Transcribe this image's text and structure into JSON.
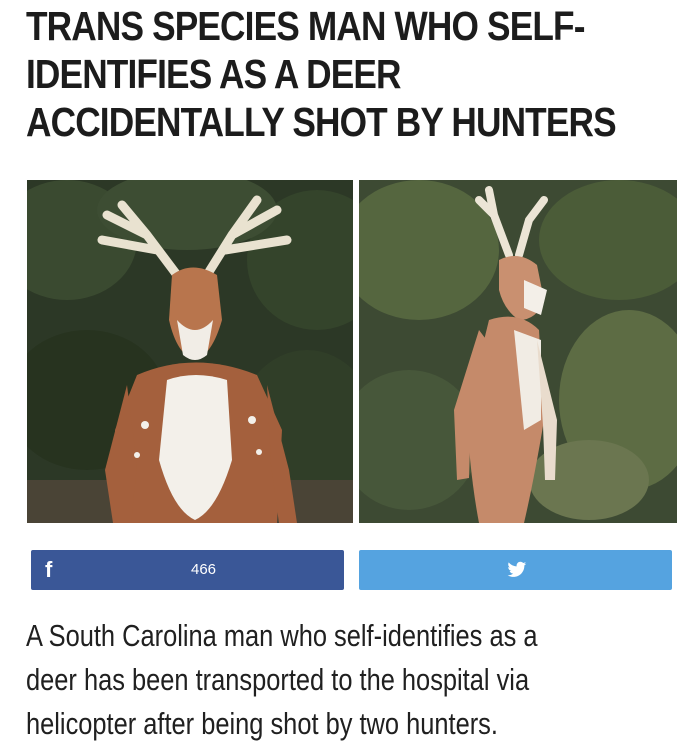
{
  "headline": {
    "lines": [
      "TRANS SPECIES MAN WHO SELF-",
      "IDENTIFIES AS A DEER",
      "ACCIDENTALLY SHOT BY HUNTERS"
    ]
  },
  "photos": {
    "left": {
      "icon": "deer-costume-photo-front"
    },
    "right": {
      "icon": "deer-costume-photo-side"
    }
  },
  "share": {
    "facebook": {
      "icon": "facebook-icon",
      "glyph": "f",
      "count": "466",
      "color": "#3a5797"
    },
    "twitter": {
      "icon": "twitter-bird-icon",
      "color": "#55a3e0"
    }
  },
  "article": {
    "lines": [
      "A South Carolina man who self-identifies as a",
      "deer has been transported to the hospital via",
      "helicopter after being shot by two hunters."
    ]
  }
}
